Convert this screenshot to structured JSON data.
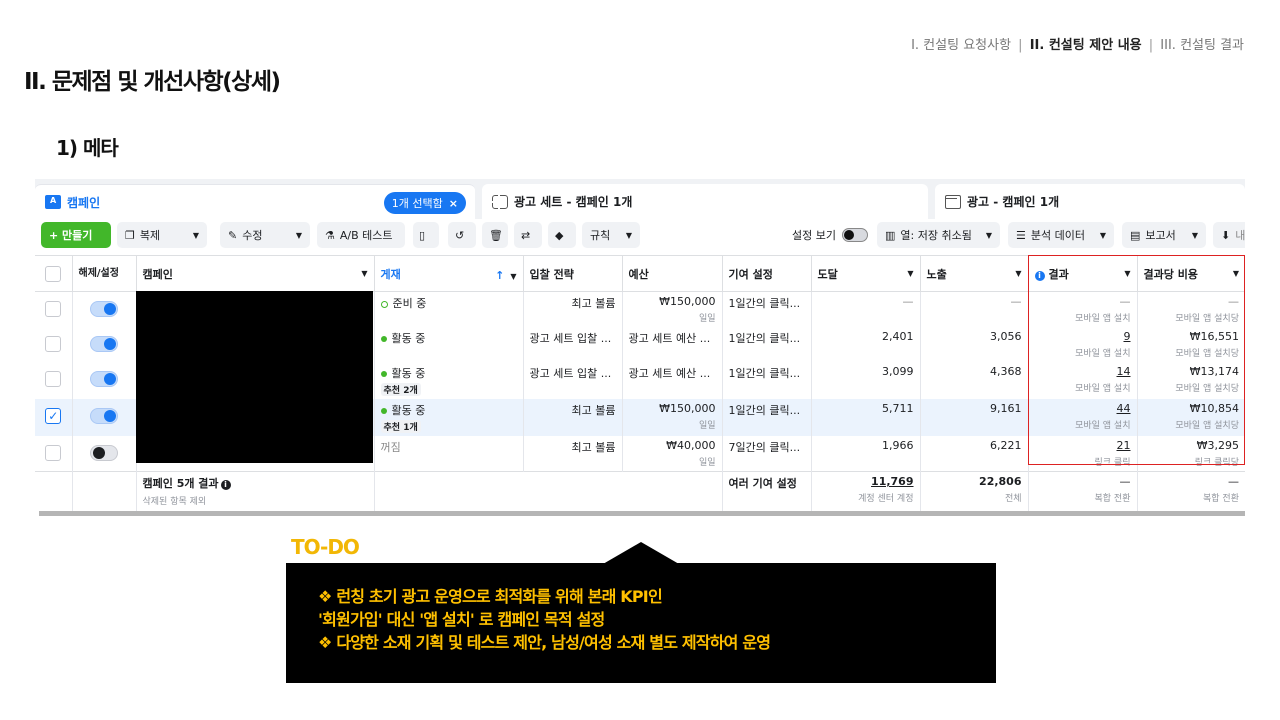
{
  "header": {
    "breadcrumb": [
      "I. 컨설팅 요청사항",
      "II. 컨설팅 제안 내용",
      "III. 컨설팅 결과"
    ],
    "sep": "|",
    "page_title": "II. 문제점 및 개선사항(상세)",
    "section_title": "1) 메타"
  },
  "ads": {
    "tabs": {
      "campaign": "캠페인",
      "selected": "1개 선택함",
      "close": "×",
      "adset": "광고 세트 - 캠페인 1개",
      "ad": "광고 - 캠페인 1개"
    },
    "toolbar": {
      "create": "+ 만들기",
      "duplicate": "복제",
      "edit": "수정",
      "ab_test": "A/B 테스트",
      "rules": "규칙",
      "view_setting": "설정 보기",
      "columns": "열: 저장 취소됨",
      "breakdown": "분석 데이터",
      "reports": "보고서",
      "export": "내"
    },
    "columns": {
      "toggle": "해제/설정",
      "campaign": "캠페인",
      "delivery": "게재",
      "sort": "↑",
      "bid": "입찰 전략",
      "budget": "예산",
      "attribution": "기여 설정",
      "reach": "도달",
      "impressions": "노출",
      "results": "결과",
      "cost": "결과당 비용"
    },
    "rows": [
      {
        "status": "준비 중",
        "rec": "",
        "bid": "최고 볼륨",
        "budget": "₩150,000",
        "budget_sub": "일일",
        "attr": "1일간의 클릭...",
        "reach": "—",
        "impr": "—",
        "result": "—",
        "result_sub": "모바일 앱 설치",
        "cost": "—",
        "cost_sub": "모바일 앱 설치당"
      },
      {
        "status": "활동 중",
        "rec": "",
        "bid": "광고 세트 입찰 ...",
        "budget": "광고 세트 예산 ...",
        "budget_sub": "",
        "attr": "1일간의 클릭...",
        "reach": "2,401",
        "impr": "3,056",
        "result": "9",
        "result_sub": "모바일 앱 설치",
        "cost": "₩16,551",
        "cost_sub": "모바일 앱 설치당"
      },
      {
        "status": "활동 중",
        "rec": "추천 2개",
        "bid": "광고 세트 입찰 ...",
        "budget": "광고 세트 예산 ...",
        "budget_sub": "",
        "attr": "1일간의 클릭...",
        "reach": "3,099",
        "impr": "4,368",
        "result": "14",
        "result_sub": "모바일 앱 설치",
        "cost": "₩13,174",
        "cost_sub": "모바일 앱 설치당"
      },
      {
        "status": "활동 중",
        "rec": "추천 1개",
        "bid": "최고 볼륨",
        "budget": "₩150,000",
        "budget_sub": "일일",
        "attr": "1일간의 클릭...",
        "reach": "5,711",
        "impr": "9,161",
        "result": "44",
        "result_sub": "모바일 앱 설치",
        "cost": "₩10,854",
        "cost_sub": "모바일 앱 설치당"
      },
      {
        "status": "꺼짐",
        "rec": "",
        "bid": "최고 볼륨",
        "budget": "₩40,000",
        "budget_sub": "일일",
        "attr": "7일간의 클릭...",
        "reach": "1,966",
        "impr": "6,221",
        "result": "21",
        "result_sub": "링크 클릭",
        "cost": "₩3,295",
        "cost_sub": "링크 클릭당"
      }
    ],
    "footer": {
      "campaigns": "캠페인 5개 결과",
      "excluded": "삭제된 항목 제외",
      "attribution": "여러 기여 설정",
      "reach": "11,769",
      "reach_sub": "계정 센터 계정",
      "impr": "22,806",
      "impr_sub": "전체",
      "result": "—",
      "result_sub": "복합 전환",
      "cost": "—",
      "cost_sub": "복합 전환"
    }
  },
  "todo": {
    "label": "TO-DO",
    "lines": [
      "❖ 런칭 초기 광고 운영으로 최적화를 위해 본래 KPI인",
      "'회원가입' 대신 '앱 설치' 로 캠페인 목적 설정",
      "❖ 다양한 소재 기획 및 테스트 제안, 남성/여성 소재 별도 제작하여 운영"
    ]
  }
}
